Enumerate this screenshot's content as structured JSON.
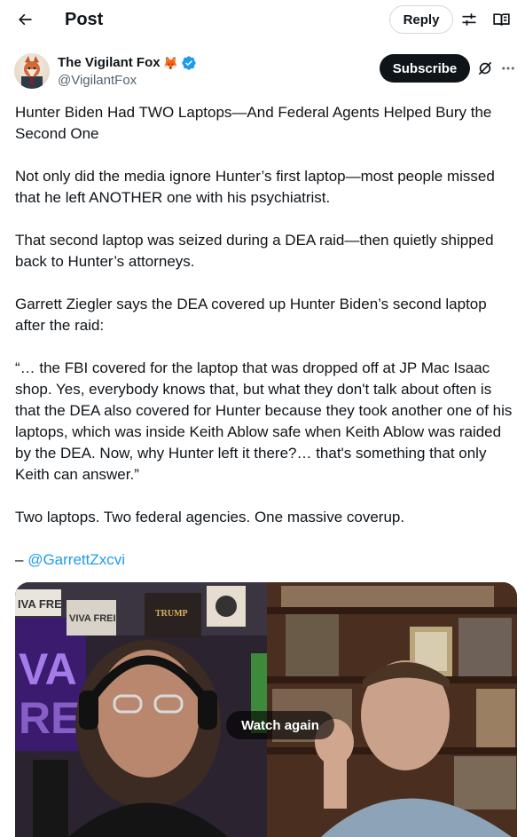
{
  "header": {
    "title": "Post",
    "reply_label": "Reply"
  },
  "author": {
    "name": "The Vigilant Fox",
    "emoji": "🦊",
    "handle": "@VigilantFox",
    "subscribe_label": "Subscribe"
  },
  "post": {
    "paragraphs": [
      "Hunter Biden Had TWO Laptops—And Federal Agents Helped Bury the Second One",
      "Not only did the media ignore Hunter’s first laptop—most people missed that he left ANOTHER one with his psychiatrist.",
      "That second laptop was seized during a DEA raid—then quietly shipped back to Hunter’s attorneys.",
      "Garrett Ziegler says the DEA covered up Hunter Biden’s second laptop after the raid:",
      "“… the FBI covered for the laptop that was dropped off at JP Mac Isaac shop. Yes, everybody knows that, but what they don't talk about often is that the DEA also covered for Hunter because they took another one of his laptops, which was inside Keith Ablow safe when Keith Ablow was raided by the DEA. Now, why Hunter left it there?… that's something that only Keith can answer.”",
      "Two laptops. Two federal agencies. One massive coverup."
    ],
    "attribution_prefix": "– ",
    "attribution_mention": "@GarrettZxcvi"
  },
  "media": {
    "watch_again_label": "Watch again",
    "sign_text_1": "IVA FREI",
    "sign_text_2": "VIVA FREI",
    "neon_text": "VA\nREI",
    "book_text": "TRUMP"
  },
  "colors": {
    "accent": "#1d9bf0",
    "verified": "#1d9bf0",
    "text": "#0f1419",
    "secondary": "#536471"
  },
  "icons": {
    "back": "arrow-left-icon",
    "adjust": "sliders-icon",
    "reader": "open-book-icon",
    "verified": "verified-badge-icon",
    "grok": "grok-icon",
    "more": "more-dots-icon"
  }
}
